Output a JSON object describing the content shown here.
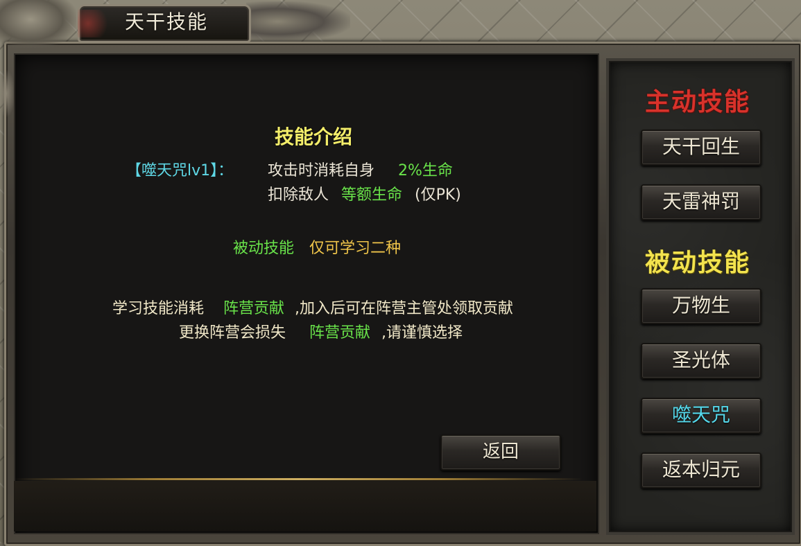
{
  "window": {
    "title": "天干技能"
  },
  "intro": {
    "heading": "技能介绍",
    "skill_tag": "【噬天咒lv1】：",
    "line1_a": "攻击时消耗自身",
    "line1_b": "2%生命",
    "line2_a": "扣除敌人",
    "line2_b": "等额生命",
    "line2_c": "(仅PK)"
  },
  "passive_note": {
    "a": "被动技能",
    "b": "仅可学习二种"
  },
  "contribution": {
    "l1_a": "学习技能消耗",
    "l1_b": "阵营贡献",
    "l1_c": ",加入后可在阵营主管处领取贡献",
    "l2_a": "更换阵营会损失",
    "l2_b": "阵营贡献",
    "l2_c": ",请谨慎选择"
  },
  "back_button": "返回",
  "sidebar": {
    "active_title": "主动技能",
    "active_skills": [
      "天干回生",
      "天雷神罚"
    ],
    "passive_title": "被动技能",
    "passive_skills": [
      "万物生",
      "圣光体",
      "噬天咒",
      "返本归元"
    ],
    "selected": "噬天咒"
  },
  "colors": {
    "highlight_green": "#69e34a",
    "highlight_yellow": "#f0c54a",
    "highlight_cyan": "#5fd8e6",
    "heading_yellow": "#f4ee6a",
    "active_title_red": "#d8322b",
    "passive_title_yellow": "#f3e34e"
  }
}
